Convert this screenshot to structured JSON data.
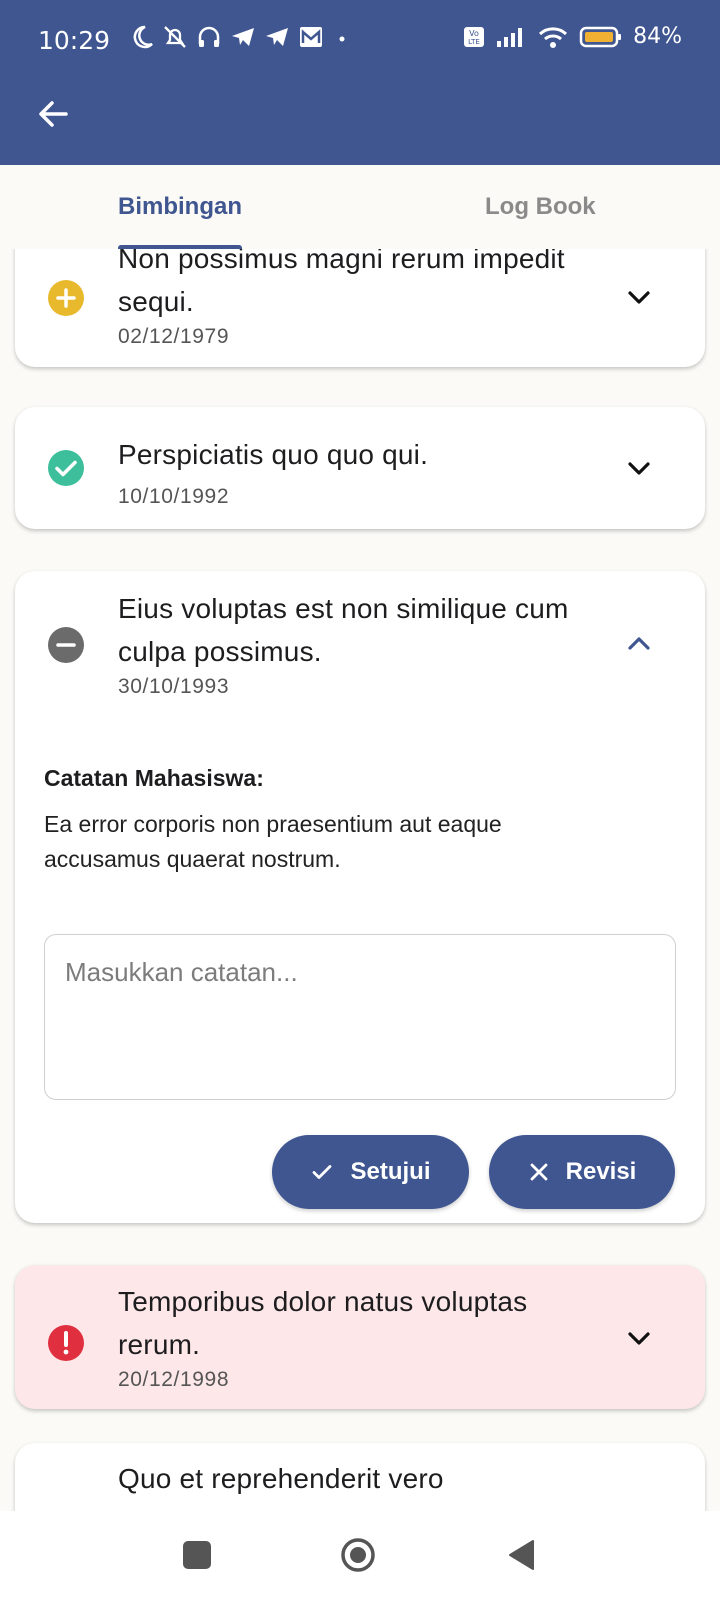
{
  "status_bar": {
    "time": "10:29",
    "battery": "84%"
  },
  "tabs": [
    {
      "label": "Bimbingan",
      "active": true
    },
    {
      "label": "Log Book",
      "active": false
    }
  ],
  "cards": [
    {
      "title": "Non possimus magni rerum impedit sequi.",
      "date": "02/12/1979",
      "status": "pending",
      "icon": "plus-circle-icon",
      "color": "#e9b92d"
    },
    {
      "title": "Perspiciatis quo quo qui.",
      "date": "10/10/1992",
      "status": "approved",
      "icon": "check-circle-icon",
      "color": "#3dbf9c"
    },
    {
      "title": "Eius voluptas est non similique cum culpa possimus.",
      "date": "30/10/1993",
      "status": "neutral",
      "icon": "minus-circle-icon",
      "color": "#6b6b6b",
      "expanded": true
    },
    {
      "title": "Temporibus dolor natus voluptas rerum.",
      "date": "20/12/1998",
      "status": "revision",
      "icon": "alert-circle-icon",
      "color": "#e0303f"
    },
    {
      "title": "Quo et reprehenderit vero",
      "date": "",
      "status": "unknown"
    }
  ],
  "expanded": {
    "notes_label": "Catatan Mahasiswa:",
    "notes_text": "Ea error corporis non praesentium aut eaque accusamus quaerat nostrum.",
    "input_placeholder": "Masukkan catatan...",
    "approve_label": "Setujui",
    "revise_label": "Revisi"
  },
  "colors": {
    "primary": "#3f5690",
    "background": "#fbfaf6",
    "alert_card": "#fde7e8"
  }
}
